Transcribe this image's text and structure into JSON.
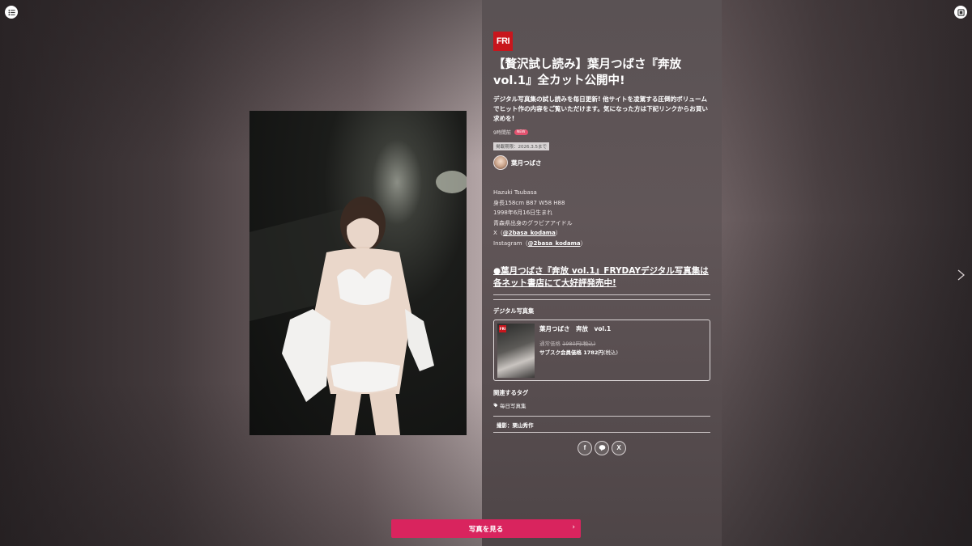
{
  "logo_text": "FRI",
  "article": {
    "title": "【贅沢試し読み】葉月つばさ『奔放 vol.1』全カット公開中!",
    "lead": "デジタル写真集の試し読みを毎日更新! 他サイトを凌駕する圧倒的ボリュームでヒット作の内容をご覧いただけます。気になった方は下記リンクからお買い求めを!",
    "time_ago": "9時間前",
    "new_badge": "NEW",
    "deadline": "掲載期限：2026.3.5まで",
    "author_name": "葉月つばさ"
  },
  "profile": {
    "name_en": "Hazuki Tsubasa",
    "stats": "身長158cm B87 W58 H88",
    "birth": "1998年6月16日生まれ",
    "origin": "青森県出身のグラビアアイドル",
    "x_prefix": "X（",
    "x_handle": "@2basa_kodama",
    "x_suffix": "）",
    "ig_prefix": "Instagram（",
    "ig_handle": "@2basa_kodama",
    "ig_suffix": "）"
  },
  "promo_link": "●葉月つばさ『奔放 vol.1』FRYDAYデジタル写真集は各ネット書店にて大好評発売中!",
  "product_section": {
    "label": "デジタル写真集",
    "title": "葉月つばさ　奔放　vol.1",
    "regular_label": "通常価格",
    "regular_price": "1980円(税込)",
    "member_label": "サブスク会員価格",
    "member_price": "1782円",
    "member_tax": "(税込)"
  },
  "tags": {
    "label": "関連するタグ",
    "items": [
      "毎日写真集"
    ]
  },
  "credit": "撮影：栗山秀作",
  "share": [
    "f",
    "LINE",
    "X"
  ],
  "cta_label": "写真を見る",
  "icons": {
    "menu": "list-icon",
    "gallery": "gallery-icon",
    "next": "chevron-right-icon",
    "tag": "tag-icon"
  },
  "colors": {
    "cta": "#d9245e",
    "logo": "#c8161d",
    "new_badge": "#e2536f"
  }
}
